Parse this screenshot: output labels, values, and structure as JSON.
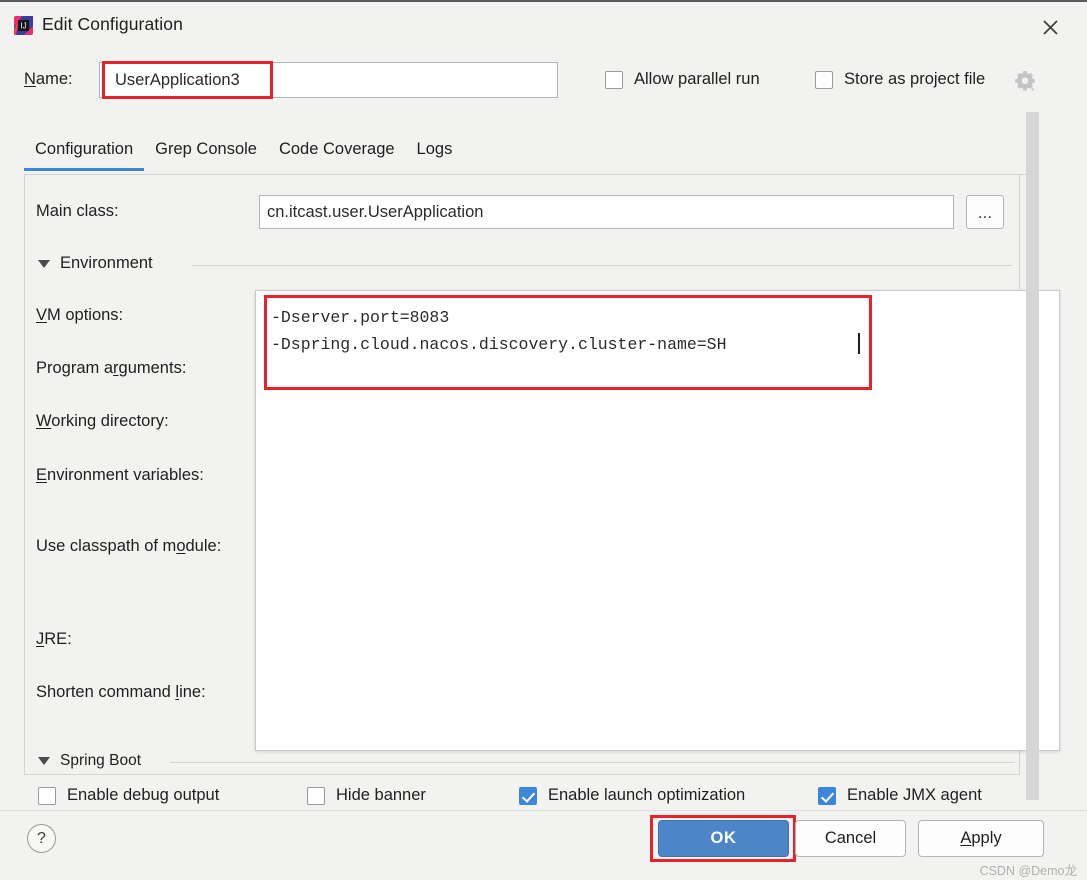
{
  "window": {
    "title": "Edit Configuration",
    "app_icon": "intellij-idea-icon",
    "close_icon": "close-icon"
  },
  "name_field": {
    "label": "Name:",
    "mnemonic": "N",
    "value": "UserApplication3",
    "placeholder": ""
  },
  "top_options": [
    {
      "label": "Allow parallel run",
      "checked": false,
      "name": "allow-parallel-run"
    },
    {
      "label": "Store as project file",
      "checked": false,
      "name": "store-as-project-file"
    }
  ],
  "gear_icon": "gear-settings-icon",
  "tabs": [
    {
      "label": "Configuration",
      "active": true
    },
    {
      "label": "Grep Console",
      "active": false
    },
    {
      "label": "Code Coverage",
      "active": false
    },
    {
      "label": "Logs",
      "active": false
    }
  ],
  "main_class": {
    "label": "Main class:",
    "value": "cn.itcast.user.UserApplication",
    "browse_label": "..."
  },
  "environment": {
    "group_title": "Environment",
    "fields": [
      {
        "label": "VM options:",
        "value": ""
      },
      {
        "label": "Program arguments:",
        "value": ""
      },
      {
        "label": "Working directory:",
        "value": ""
      },
      {
        "label": "Environment variables:",
        "value": ""
      },
      {
        "label": "Use classpath of module:",
        "value": ""
      },
      {
        "label": "JRE:",
        "value": ""
      },
      {
        "label": "Shorten command line:",
        "value": ""
      }
    ]
  },
  "vm_options_editor": {
    "line1": "-Dserver.port=8083",
    "line2": "-Dspring.cloud.nacos.discovery.cluster-name=SH",
    "text": "-Dserver.port=8083\n-Dspring.cloud.nacos.discovery.cluster-name=SH"
  },
  "spring_boot": {
    "group_title": "Spring Boot",
    "options": [
      {
        "label": "Enable debug output",
        "checked": false,
        "name": "enable-debug-output"
      },
      {
        "label": "Hide banner",
        "checked": false,
        "name": "hide-banner"
      },
      {
        "label": "Enable launch optimization",
        "checked": true,
        "name": "enable-launch-optimization"
      },
      {
        "label": "Enable JMX agent",
        "checked": true,
        "name": "enable-jmx-agent"
      }
    ]
  },
  "footer": {
    "help_label": "?",
    "ok_label": "OK",
    "cancel_label": "Cancel",
    "apply_label": "Apply"
  },
  "watermark": "CSDN @Demo龙",
  "colors": {
    "accent_blue": "#3d86d9",
    "ok_button_blue": "#4c86c9",
    "highlight_red": "#e8212a",
    "dialog_bg": "#f2f2f0"
  }
}
